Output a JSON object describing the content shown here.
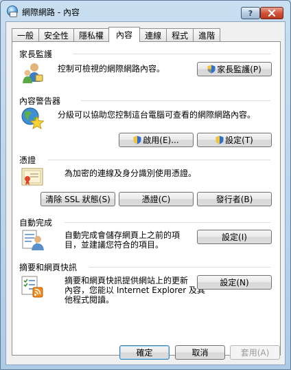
{
  "window": {
    "title": "網際網路 - 內容"
  },
  "tabs": [
    {
      "label": "一般"
    },
    {
      "label": "安全性"
    },
    {
      "label": "隱私權"
    },
    {
      "label": "內容"
    },
    {
      "label": "連線"
    },
    {
      "label": "程式"
    },
    {
      "label": "進階"
    }
  ],
  "active_tab": "內容",
  "sections": {
    "family": {
      "title": "家長監護",
      "desc": "控制可檢視的網際網路內容。",
      "button": "家長監護(P)"
    },
    "advisor": {
      "title": "內容警告器",
      "desc": "分級可以協助您控制這台電腦可查看的網際網路內容。",
      "enable_button": "啟用(E)...",
      "settings_button": "設定(T)"
    },
    "certs": {
      "title": "憑證",
      "desc": "為加密的連線及身分識別使用憑證。",
      "clear_ssl_button": "清除 SSL 狀態(S)",
      "certs_button": "憑證(C)",
      "publishers_button": "發行者(B)"
    },
    "autocomplete": {
      "title": "自動完成",
      "desc_line1": "自動完成會儲存網頁上之前的項",
      "desc_line2": "目，並建議您符合的項目。",
      "settings_button": "設定(I)"
    },
    "feeds": {
      "title": "摘要和網頁快訊",
      "desc_line1": "摘要和網頁快訊提供網站上的更新",
      "desc_line2": "內容，您能以 Internet Explorer 及其",
      "desc_line3": "他程式閱讀。",
      "settings_button": "設定(N)"
    }
  },
  "footer": {
    "ok": "確定",
    "cancel": "取消",
    "apply": "套用(A)"
  }
}
